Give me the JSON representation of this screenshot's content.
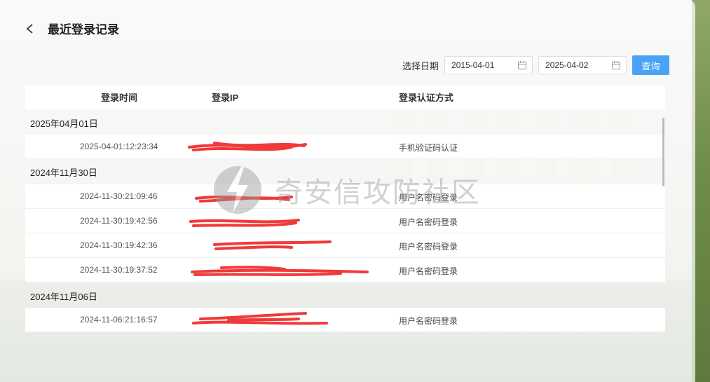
{
  "header": {
    "title": "最近登录记录"
  },
  "filter": {
    "label": "选择日期",
    "start_date": "2015-04-01",
    "end_date": "2025-04-02",
    "query_button": "查询"
  },
  "table": {
    "columns": [
      "登录时间",
      "登录IP",
      "登录认证方式"
    ],
    "groups": [
      {
        "date": "2025年04月01日",
        "rows": [
          {
            "time": "2025-04-01:12:23:34",
            "method": "手机验证码认证"
          }
        ]
      },
      {
        "date": "2024年11月30日",
        "rows": [
          {
            "time": "2024-11-30:21:09:46",
            "method": "用户名密码登录"
          },
          {
            "time": "2024-11-30:19:42:56",
            "method": "用户名密码登录"
          },
          {
            "time": "2024-11-30:19:42:36",
            "method": "用户名密码登录"
          },
          {
            "time": "2024-11-30:19:37:52",
            "method": "用户名密码登录"
          }
        ]
      },
      {
        "date": "2024年11月06日",
        "rows": [
          {
            "time": "2024-11-06:21:16:57",
            "method": "用户名密码登录"
          }
        ]
      }
    ]
  },
  "watermark": {
    "text": "奇安信攻防社区"
  },
  "colors": {
    "accent": "#4aa3f5",
    "redaction": "#f03a3a"
  }
}
